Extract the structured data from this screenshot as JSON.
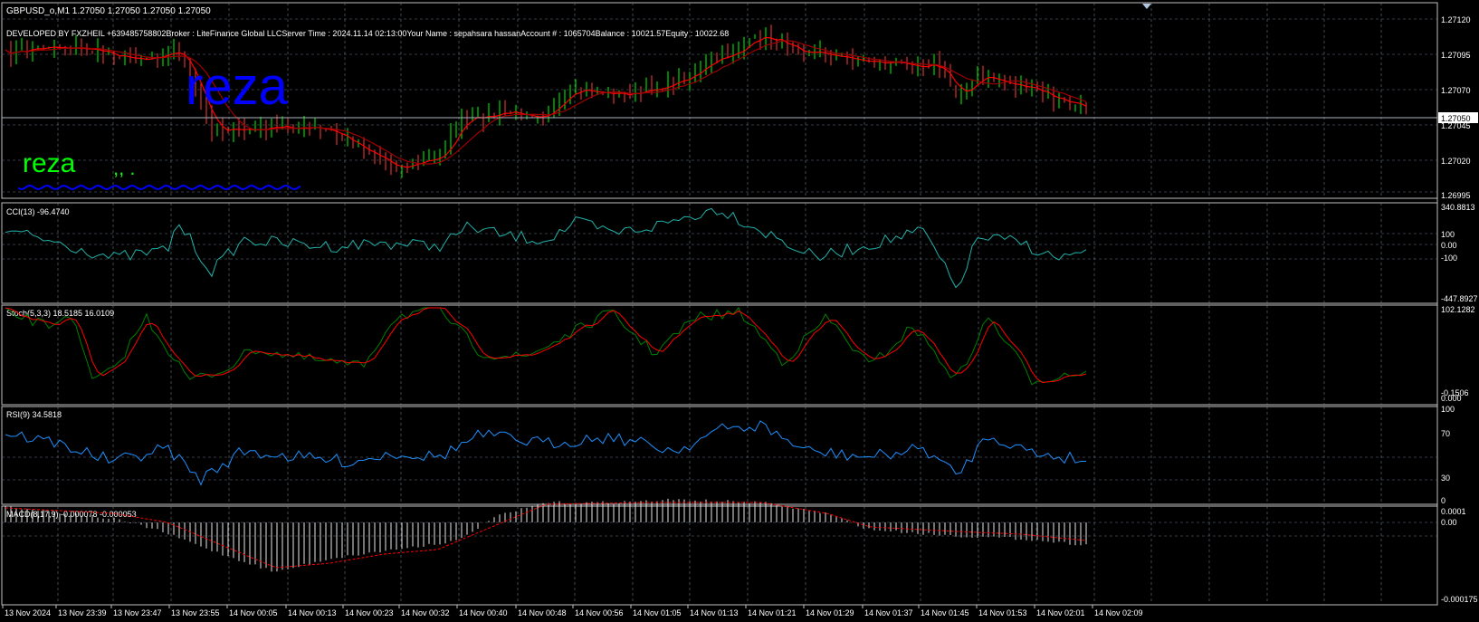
{
  "main": {
    "header": "GBPUSD_o,M1  1.27050 1.27050 1.27050 1.27050",
    "info": "DEVELOPED BY FXZHEIL +639485758802Broker  : LiteFinance Global LLCServer Time : 2024.11.14 02:13:00Your Name    : sepahsara hassanAccount #  : 1065704Balance : 10021.57Equity   : 10022.68",
    "watermark_big": "reza",
    "watermark_small": "reza",
    "watermark_marks": ",, .",
    "price_labels": [
      "1.27120",
      "1.27095",
      "1.27070",
      "1.27045",
      "1.27020",
      "1.26995"
    ],
    "current_price": "1.27050"
  },
  "cci": {
    "label": "CCI(13) -96.4740",
    "scale": [
      "340.8813",
      "100",
      "0.00",
      "-100",
      "-447.8927"
    ]
  },
  "stoch": {
    "label": "Stoch(5,3,3) 18.5185 16.0109",
    "scale": [
      "102.1282",
      "0.000",
      "-0.1506"
    ]
  },
  "rsi": {
    "label": "RSI(9) 34.5818",
    "scale": [
      "100",
      "70",
      "30",
      "0"
    ]
  },
  "macd": {
    "label": "MACD(8,17,9) -0.000078 -0.000053",
    "scale": [
      "0.0001",
      "0.00",
      "-0.000175"
    ]
  },
  "time_axis": [
    "13 Nov 2024",
    "13 Nov 23:39",
    "13 Nov 23:47",
    "13 Nov 23:55",
    "14 Nov 00:05",
    "14 Nov 00:13",
    "14 Nov 00:23",
    "14 Nov 00:32",
    "14 Nov 00:40",
    "14 Nov 00:48",
    "14 Nov 00:56",
    "14 Nov 01:05",
    "14 Nov 01:13",
    "14 Nov 01:21",
    "14 Nov 01:29",
    "14 Nov 01:37",
    "14 Nov 01:45",
    "14 Nov 01:53",
    "14 Nov 02:01",
    "14 Nov 02:09"
  ],
  "colors": {
    "bull": "#00ff00",
    "bear": "#ff3a3a",
    "ma": "#ff0000",
    "cci": "#20b2aa",
    "stoch_main": "#008000",
    "stoch_signal": "#ff0000",
    "rsi": "#1e90ff",
    "macd_signal": "#ff0000",
    "grid": "#6b7b8c",
    "watermark_big": "#0000ff",
    "watermark_small": "#00ff00"
  }
}
